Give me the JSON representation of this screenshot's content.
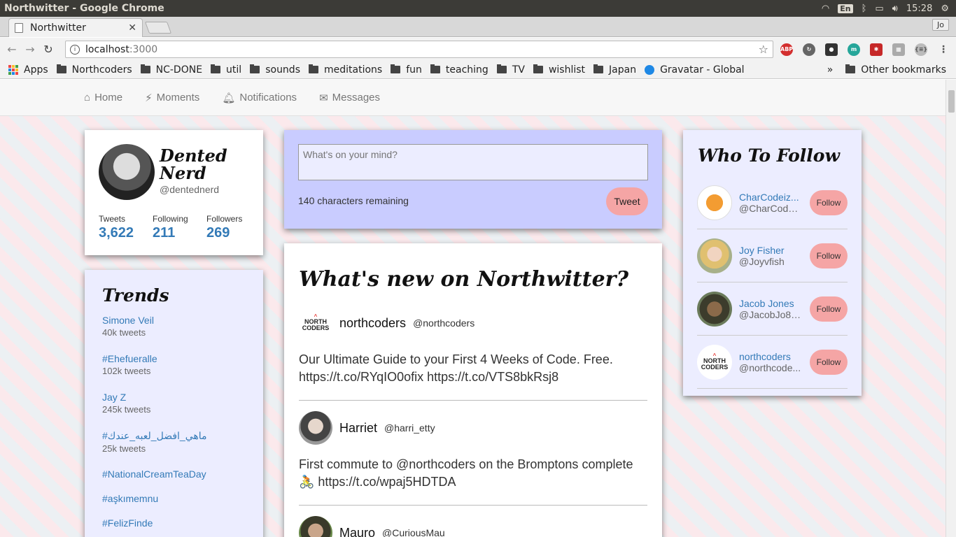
{
  "os": {
    "window_title": "Northwitter - Google Chrome",
    "keyboard": "En",
    "time": "15:28"
  },
  "browser": {
    "tab_title": "Northwitter",
    "profile": "Jo",
    "url_host": "localhost",
    "url_port": ":3000",
    "bookmarks": [
      "Apps",
      "Northcoders",
      "NC-DONE",
      "util",
      "sounds",
      "meditations",
      "fun",
      "teaching",
      "TV",
      "wishlist",
      "Japan",
      "Gravatar - Global"
    ],
    "overflow": "»",
    "other_bookmarks": "Other bookmarks"
  },
  "nav": {
    "home": "Home",
    "moments": "Moments",
    "notifications": "Notifications",
    "messages": "Messages"
  },
  "profile": {
    "name_line1": "Dented",
    "name_line2": "Nerd",
    "handle": "@dentednerd",
    "stats": [
      {
        "label": "Tweets",
        "value": "3,622"
      },
      {
        "label": "Following",
        "value": "211"
      },
      {
        "label": "Followers",
        "value": "269"
      }
    ]
  },
  "trends": {
    "title": "Trends",
    "items": [
      {
        "name": "Simone Veil",
        "count": "40k tweets"
      },
      {
        "name": "#Ehefueralle",
        "count": "102k tweets"
      },
      {
        "name": "Jay Z",
        "count": "245k tweets"
      },
      {
        "name": "#ماهي_افضل_لعبه_عندك",
        "count": "25k tweets"
      },
      {
        "name": "#NationalCreamTeaDay",
        "count": ""
      },
      {
        "name": "#aşkımemnu",
        "count": ""
      },
      {
        "name": "#FelizFinde",
        "count": ""
      }
    ]
  },
  "compose": {
    "placeholder": "What's on your mind?",
    "remaining": "140 characters remaining",
    "button": "Tweet"
  },
  "feed": {
    "title": "What's new on Northwitter?",
    "tweets": [
      {
        "name": "northcoders",
        "handle": "@northcoders",
        "text": "Our Ultimate Guide to your First 4 Weeks of Code. Free. https://t.co/RYqIO0ofix https://t.co/VTS8bkRsj8"
      },
      {
        "name": "Harriet",
        "handle": "@harri_etty",
        "text": "First commute to @northcoders on the Bromptons complete 🚴 https://t.co/wpaj5HDTDA"
      },
      {
        "name": "Mauro",
        "handle": "@CuriousMau",
        "text": ""
      }
    ]
  },
  "who_to_follow": {
    "title": "Who To Follow",
    "button": "Follow",
    "users": [
      {
        "name": "CharCodeiz...",
        "handle": "@CharCodei..."
      },
      {
        "name": "Joy Fisher",
        "handle": "@Joyvfish"
      },
      {
        "name": "Jacob Jones",
        "handle": "@JacobJo88..."
      },
      {
        "name": "northcoders",
        "handle": "@northcode..."
      }
    ]
  },
  "northcoders_logo": {
    "line1": "NORTH",
    "line2": "CODERS"
  }
}
